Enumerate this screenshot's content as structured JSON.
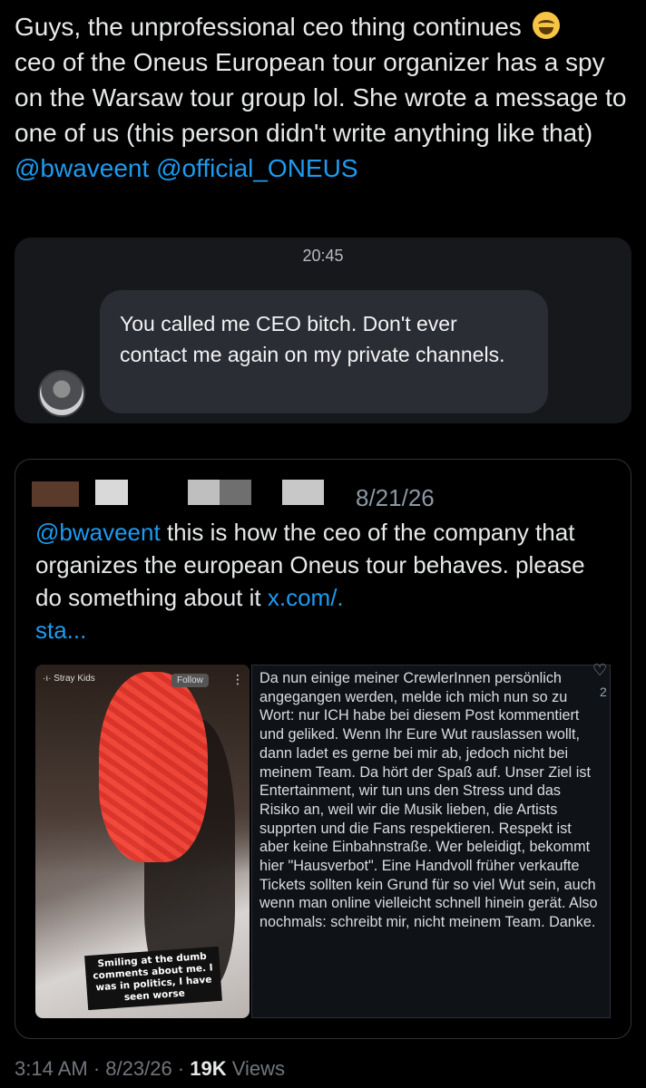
{
  "tweet": {
    "text": "Guys, the unprofessional ceo thing continues",
    "text_2": "ceo of the Oneus European tour organizer has a spy on the Warsaw tour group lol. She wrote a message to one of us (this person didn't write anything like that)",
    "mention_1": "@bwaveent",
    "mention_2": "@official_ONEUS",
    "emoji_icon": "laughing-crying-face"
  },
  "dm": {
    "time": "20:45",
    "message": "You called me CEO bitch. Don't ever contact me again on my private channels."
  },
  "quote": {
    "date": "8/21/26",
    "mention": "@bwaveent",
    "text": "this is how the ceo of the company that organizes the european Oneus tour behaves. please do something about it",
    "link": "x.com/.",
    "link_2": "sta...",
    "redaction_colors": [
      "#5a3a2a",
      "#d9d9d9",
      "#bfbfbf",
      "#c8c8c8"
    ]
  },
  "story": {
    "account": "·ı· Stray Kids",
    "follow": "Follow",
    "caption": "Smiling at the dumb comments about me. I was in politics, I have seen worse"
  },
  "german_post": {
    "text": "Da nun einige meiner CrewlerInnen persönlich angegangen werden, melde ich mich nun so zu Wort: nur ICH habe bei diesem Post kommentiert und geliked. Wenn Ihr Eure Wut rauslassen wollt, dann ladet es gerne bei mir ab, jedoch nicht bei meinem Team. Da hört der Spaß auf. Unser Ziel ist Entertainment, wir tun uns den Stress und das Risiko an, weil wir die Musik lieben, die Artists supprten und die Fans respektieren. Respekt ist aber keine Einbahnstraße. Wer beleidigt, bekommt hier \"Hausverbot\". Eine Handvoll früher verkaufte Tickets sollten kein Grund für so viel Wut sein, auch wenn man online vielleicht schnell hinein gerät. Also nochmals: schreibt mir, nicht meinem Team. Danke.",
    "like_count": "2"
  },
  "meta": {
    "time": "3:14 AM",
    "date": "8/23/26",
    "views_count": "19K",
    "views_label": "Views"
  }
}
